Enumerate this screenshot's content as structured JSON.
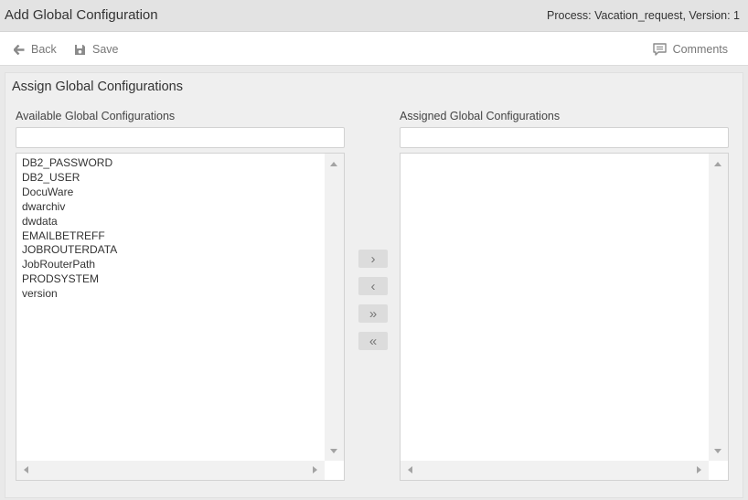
{
  "header": {
    "title": "Add Global Configuration",
    "process_info": "Process: Vacation_request, Version: 1"
  },
  "toolbar": {
    "back_label": "Back",
    "save_label": "Save",
    "comments_label": "Comments"
  },
  "panel": {
    "title": "Assign Global Configurations",
    "available": {
      "label": "Available Global Configurations",
      "filter_value": "",
      "items": [
        "DB2_PASSWORD",
        "DB2_USER",
        "DocuWare",
        "dwarchiv",
        "dwdata",
        "EMAILBETREFF",
        "JOBROUTERDATA",
        "JobRouterPath",
        "PRODSYSTEM",
        "version"
      ]
    },
    "assigned": {
      "label": "Assigned Global Configurations",
      "filter_value": "",
      "items": []
    },
    "buttons": {
      "move_right": "›",
      "move_left": "‹",
      "move_all_right": "»",
      "move_all_left": "«"
    }
  },
  "icons": {
    "back": "arrow-left-icon",
    "save": "floppy-disk-icon",
    "comments": "comment-icon"
  },
  "colors": {
    "title_bar": "#e3e3e3",
    "panel_bg": "#efefef",
    "button_bg": "#dcdcdc"
  }
}
